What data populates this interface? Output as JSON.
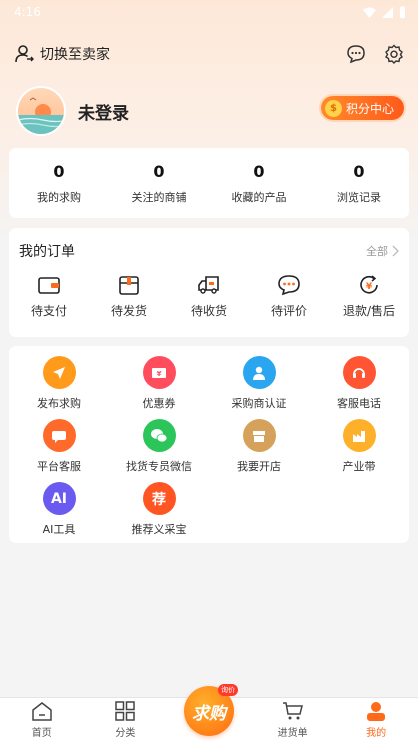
{
  "status_bar": {
    "time": "4:16"
  },
  "header": {
    "switch_label": "切换至卖家"
  },
  "profile": {
    "login_text": "未登录",
    "points_label": "积分中心",
    "coin_symbol": "$"
  },
  "stats": [
    {
      "value": "0",
      "label": "我的求购"
    },
    {
      "value": "0",
      "label": "关注的商铺"
    },
    {
      "value": "0",
      "label": "收藏的产品"
    },
    {
      "value": "0",
      "label": "浏览记录"
    }
  ],
  "orders": {
    "title": "我的订单",
    "all_label": "全部",
    "items": [
      {
        "label": "待支付",
        "icon": "wallet-icon"
      },
      {
        "label": "待发货",
        "icon": "box-icon"
      },
      {
        "label": "待收货",
        "icon": "truck-icon"
      },
      {
        "label": "待评价",
        "icon": "comment-icon"
      },
      {
        "label": "退款/售后",
        "icon": "refund-icon"
      }
    ]
  },
  "tools": [
    {
      "label": "发布求购",
      "icon": "send-icon",
      "color": "#ff9a1a",
      "glyph": ""
    },
    {
      "label": "优惠券",
      "icon": "coupon-icon",
      "color": "#ff4d5e",
      "glyph": ""
    },
    {
      "label": "采购商认证",
      "icon": "user-verify-icon",
      "color": "#2aa6f0",
      "glyph": ""
    },
    {
      "label": "客服电话",
      "icon": "headset-icon",
      "color": "#ff5533",
      "glyph": ""
    },
    {
      "label": "平台客服",
      "icon": "chat-icon",
      "color": "#ff6a2a",
      "glyph": ""
    },
    {
      "label": "找货专员微信",
      "icon": "wechat-icon",
      "color": "#2bc55a",
      "glyph": ""
    },
    {
      "label": "我要开店",
      "icon": "shop-icon",
      "color": "#d6a15a",
      "glyph": ""
    },
    {
      "label": "产业带",
      "icon": "factory-icon",
      "color": "#ffb02a",
      "glyph": ""
    },
    {
      "label": "AI工具",
      "icon": "ai-icon",
      "color": "#6a5af0",
      "glyph": "AI"
    },
    {
      "label": "推荐义采宝",
      "icon": "recommend-icon",
      "color": "#ff5522",
      "glyph": "荐"
    }
  ],
  "tabbar": {
    "items": [
      {
        "label": "首页",
        "icon": "home-icon"
      },
      {
        "label": "分类",
        "icon": "grid-icon"
      },
      {
        "label": "进货单",
        "icon": "cart-icon"
      },
      {
        "label": "我的",
        "icon": "person-icon"
      }
    ],
    "center_label": "求购",
    "center_badge": "询价"
  },
  "colors": {
    "accent": "#ff6a1a"
  }
}
